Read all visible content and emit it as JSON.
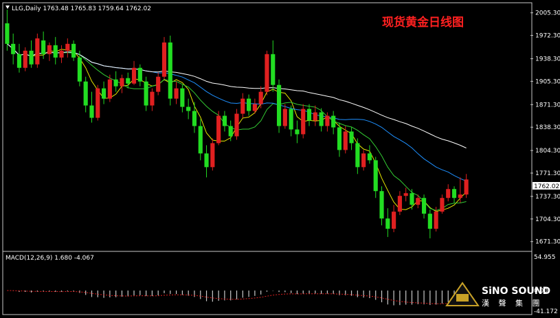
{
  "window": {
    "symbol_line": "LLG,Daily  1763.48 1765.83 1759.64 1762.02",
    "title": "现货黄金日线图",
    "current_price_label": "1762.02"
  },
  "macd_panel": {
    "label": "MACD(12,26,9) 1.680 -4.067",
    "ticks": [
      "54.955",
      "0.00",
      "-41.172"
    ]
  },
  "branding": {
    "name": "SiNO SOUND",
    "subtitle": "漢 聲 集 團"
  },
  "colors": {
    "background": "#000000",
    "bull_candle": "#e02020",
    "bear_candle": "#22dd22",
    "ma_white": "#ffffff",
    "ma_blue": "#1e90ff",
    "ma_green": "#33cc33",
    "ma_yellow": "#e6e600",
    "macd_hist": "#cccccc",
    "macd_signal": "#e02020"
  },
  "chart_data": {
    "type": "candlestick",
    "y_ticks": [
      2005.3,
      1972.3,
      1938.3,
      1905.3,
      1871.3,
      1838.3,
      1804.3,
      1771.3,
      1737.3,
      1704.3,
      1671.3
    ],
    "ylim": [
      1659,
      2018
    ],
    "candles": [
      {
        "o": 1990,
        "h": 2010,
        "c": 1960,
        "l": 1950
      },
      {
        "o": 1960,
        "h": 1975,
        "c": 1945,
        "l": 1930
      },
      {
        "o": 1945,
        "h": 1960,
        "c": 1925,
        "l": 1918
      },
      {
        "o": 1925,
        "h": 1955,
        "c": 1950,
        "l": 1920
      },
      {
        "o": 1950,
        "h": 1965,
        "c": 1930,
        "l": 1925
      },
      {
        "o": 1930,
        "h": 1975,
        "c": 1968,
        "l": 1925
      },
      {
        "o": 1965,
        "h": 1978,
        "c": 1945,
        "l": 1938
      },
      {
        "o": 1945,
        "h": 1962,
        "c": 1958,
        "l": 1935
      },
      {
        "o": 1958,
        "h": 1970,
        "c": 1940,
        "l": 1930
      },
      {
        "o": 1940,
        "h": 1958,
        "c": 1950,
        "l": 1932
      },
      {
        "o": 1950,
        "h": 1968,
        "c": 1960,
        "l": 1940
      },
      {
        "o": 1960,
        "h": 1965,
        "c": 1940,
        "l": 1935
      },
      {
        "o": 1940,
        "h": 1950,
        "c": 1905,
        "l": 1898
      },
      {
        "o": 1905,
        "h": 1912,
        "c": 1870,
        "l": 1860
      },
      {
        "o": 1870,
        "h": 1890,
        "c": 1852,
        "l": 1845
      },
      {
        "o": 1852,
        "h": 1900,
        "c": 1895,
        "l": 1848
      },
      {
        "o": 1895,
        "h": 1905,
        "c": 1880,
        "l": 1872
      },
      {
        "o": 1880,
        "h": 1915,
        "c": 1908,
        "l": 1875
      },
      {
        "o": 1908,
        "h": 1920,
        "c": 1898,
        "l": 1890
      },
      {
        "o": 1898,
        "h": 1915,
        "c": 1910,
        "l": 1888
      },
      {
        "o": 1910,
        "h": 1918,
        "c": 1902,
        "l": 1895
      },
      {
        "o": 1902,
        "h": 1935,
        "c": 1925,
        "l": 1900
      },
      {
        "o": 1925,
        "h": 1930,
        "c": 1905,
        "l": 1898
      },
      {
        "o": 1905,
        "h": 1912,
        "c": 1870,
        "l": 1862
      },
      {
        "o": 1870,
        "h": 1895,
        "c": 1890,
        "l": 1862
      },
      {
        "o": 1890,
        "h": 1918,
        "c": 1912,
        "l": 1885
      },
      {
        "o": 1912,
        "h": 1970,
        "c": 1962,
        "l": 1908
      },
      {
        "o": 1962,
        "h": 1972,
        "c": 1880,
        "l": 1870
      },
      {
        "o": 1880,
        "h": 1905,
        "c": 1895,
        "l": 1872
      },
      {
        "o": 1895,
        "h": 1900,
        "c": 1868,
        "l": 1860
      },
      {
        "o": 1868,
        "h": 1880,
        "c": 1862,
        "l": 1850
      },
      {
        "o": 1862,
        "h": 1875,
        "c": 1840,
        "l": 1830
      },
      {
        "o": 1840,
        "h": 1850,
        "c": 1800,
        "l": 1790
      },
      {
        "o": 1800,
        "h": 1812,
        "c": 1780,
        "l": 1765
      },
      {
        "o": 1780,
        "h": 1822,
        "c": 1815,
        "l": 1775
      },
      {
        "o": 1815,
        "h": 1862,
        "c": 1855,
        "l": 1812
      },
      {
        "o": 1855,
        "h": 1862,
        "c": 1840,
        "l": 1832
      },
      {
        "o": 1840,
        "h": 1848,
        "c": 1825,
        "l": 1818
      },
      {
        "o": 1825,
        "h": 1865,
        "c": 1858,
        "l": 1820
      },
      {
        "o": 1858,
        "h": 1888,
        "c": 1880,
        "l": 1852
      },
      {
        "o": 1880,
        "h": 1886,
        "c": 1862,
        "l": 1855
      },
      {
        "o": 1862,
        "h": 1880,
        "c": 1872,
        "l": 1858
      },
      {
        "o": 1872,
        "h": 1898,
        "c": 1890,
        "l": 1866
      },
      {
        "o": 1890,
        "h": 1950,
        "c": 1945,
        "l": 1885
      },
      {
        "o": 1945,
        "h": 1965,
        "c": 1900,
        "l": 1890
      },
      {
        "o": 1900,
        "h": 1908,
        "c": 1840,
        "l": 1830
      },
      {
        "o": 1840,
        "h": 1872,
        "c": 1865,
        "l": 1836
      },
      {
        "o": 1865,
        "h": 1870,
        "c": 1835,
        "l": 1825
      },
      {
        "o": 1835,
        "h": 1848,
        "c": 1828,
        "l": 1815
      },
      {
        "o": 1828,
        "h": 1872,
        "c": 1865,
        "l": 1822
      },
      {
        "o": 1865,
        "h": 1872,
        "c": 1848,
        "l": 1840
      },
      {
        "o": 1848,
        "h": 1870,
        "c": 1860,
        "l": 1840
      },
      {
        "o": 1860,
        "h": 1866,
        "c": 1840,
        "l": 1832
      },
      {
        "o": 1840,
        "h": 1860,
        "c": 1855,
        "l": 1832
      },
      {
        "o": 1855,
        "h": 1862,
        "c": 1838,
        "l": 1828
      },
      {
        "o": 1838,
        "h": 1845,
        "c": 1805,
        "l": 1795
      },
      {
        "o": 1805,
        "h": 1840,
        "c": 1832,
        "l": 1800
      },
      {
        "o": 1832,
        "h": 1838,
        "c": 1815,
        "l": 1805
      },
      {
        "o": 1815,
        "h": 1822,
        "c": 1780,
        "l": 1770
      },
      {
        "o": 1780,
        "h": 1805,
        "c": 1800,
        "l": 1775
      },
      {
        "o": 1800,
        "h": 1812,
        "c": 1790,
        "l": 1785
      },
      {
        "o": 1790,
        "h": 1795,
        "c": 1745,
        "l": 1735
      },
      {
        "o": 1745,
        "h": 1752,
        "c": 1705,
        "l": 1695
      },
      {
        "o": 1705,
        "h": 1720,
        "c": 1690,
        "l": 1678
      },
      {
        "o": 1690,
        "h": 1725,
        "c": 1715,
        "l": 1685
      },
      {
        "o": 1715,
        "h": 1745,
        "c": 1738,
        "l": 1710
      },
      {
        "o": 1738,
        "h": 1750,
        "c": 1742,
        "l": 1730
      },
      {
        "o": 1742,
        "h": 1748,
        "c": 1725,
        "l": 1718
      },
      {
        "o": 1725,
        "h": 1740,
        "c": 1735,
        "l": 1720
      },
      {
        "o": 1735,
        "h": 1740,
        "c": 1712,
        "l": 1705
      },
      {
        "o": 1712,
        "h": 1718,
        "c": 1690,
        "l": 1676
      },
      {
        "o": 1690,
        "h": 1722,
        "c": 1715,
        "l": 1686
      },
      {
        "o": 1715,
        "h": 1740,
        "c": 1735,
        "l": 1712
      },
      {
        "o": 1735,
        "h": 1755,
        "c": 1748,
        "l": 1730
      },
      {
        "o": 1748,
        "h": 1752,
        "c": 1735,
        "l": 1728
      },
      {
        "o": 1735,
        "h": 1765,
        "c": 1740,
        "l": 1728
      },
      {
        "o": 1740,
        "h": 1770,
        "c": 1762,
        "l": 1735
      }
    ]
  }
}
